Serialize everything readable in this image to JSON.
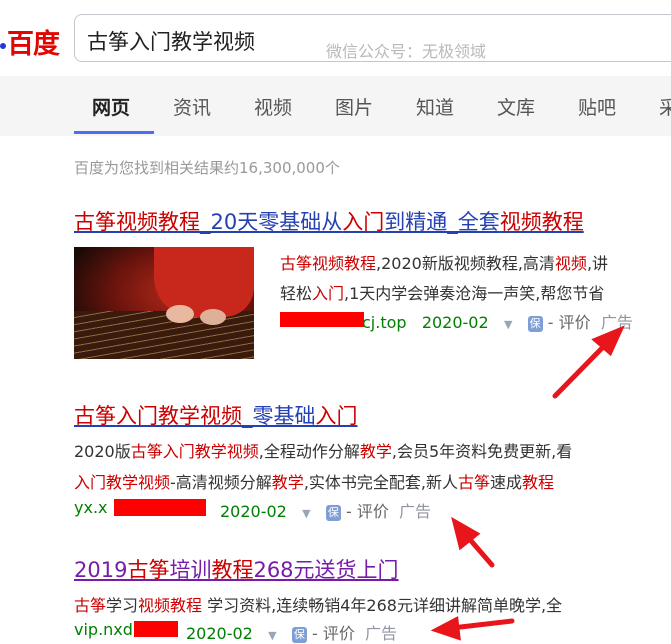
{
  "header": {
    "logo": "百度",
    "query": "古筝入门教学视频",
    "watermark": "微信公众号：无极领域"
  },
  "tabs": [
    "网页",
    "资讯",
    "视频",
    "图片",
    "知道",
    "文库",
    "贴吧",
    "采"
  ],
  "stats": "百度为您找到相关结果约16,300,000个",
  "results": [
    {
      "title_parts": [
        "古筝视频教程",
        "_20天零基础从",
        "入门",
        "到精通_全套",
        "视频教程"
      ],
      "lines": [
        [
          "古筝视频教程",
          ",2020新版视频教程,高清",
          "视频",
          ",讲"
        ],
        [
          "轻松",
          "入门",
          ",1天内学会弹奏沧海一声笑,帮您节省"
        ]
      ],
      "domain_tail": "cj.top",
      "date": "2020-02",
      "dash": "-",
      "review": "评价",
      "ad": "广告",
      "bao": "保"
    },
    {
      "title_parts": [
        "古筝入门教学视频",
        "_零基础",
        "入门"
      ],
      "lines": [
        [
          "2020版",
          "古筝入门教学视频",
          ",全程动作分解",
          "教学",
          ",会员5年资料免费更新,看"
        ],
        [
          "入门教学视频",
          "-高清视频分解",
          "教学",
          ",实体书完全配套,新人",
          "古筝",
          "速成",
          "教程"
        ]
      ],
      "domain_head": "yx.x",
      "date": "2020-02",
      "dash": "-",
      "review": "评价",
      "ad": "广告",
      "bao": "保"
    },
    {
      "title_parts": [
        "2019",
        "古筝",
        "培训",
        "教程",
        "268元送货上门"
      ],
      "lines": [
        [
          "古筝",
          "学习",
          "视频教程",
          " 学习资料,连续畅销4年268元详细讲解简单晚学,全"
        ]
      ],
      "domain_head": "vip.nxd",
      "date": "2020-02",
      "dash": "-",
      "review": "评价",
      "ad": "广告",
      "bao": "保"
    }
  ],
  "colors": {
    "brand_red": "#e10601",
    "link_blue": "#2440b3",
    "highlight_red": "#cc0000",
    "visited_purple": "#771caa",
    "url_green": "#008000",
    "tab_accent": "#4e6ef2",
    "annotation_red": "#e8151b"
  }
}
